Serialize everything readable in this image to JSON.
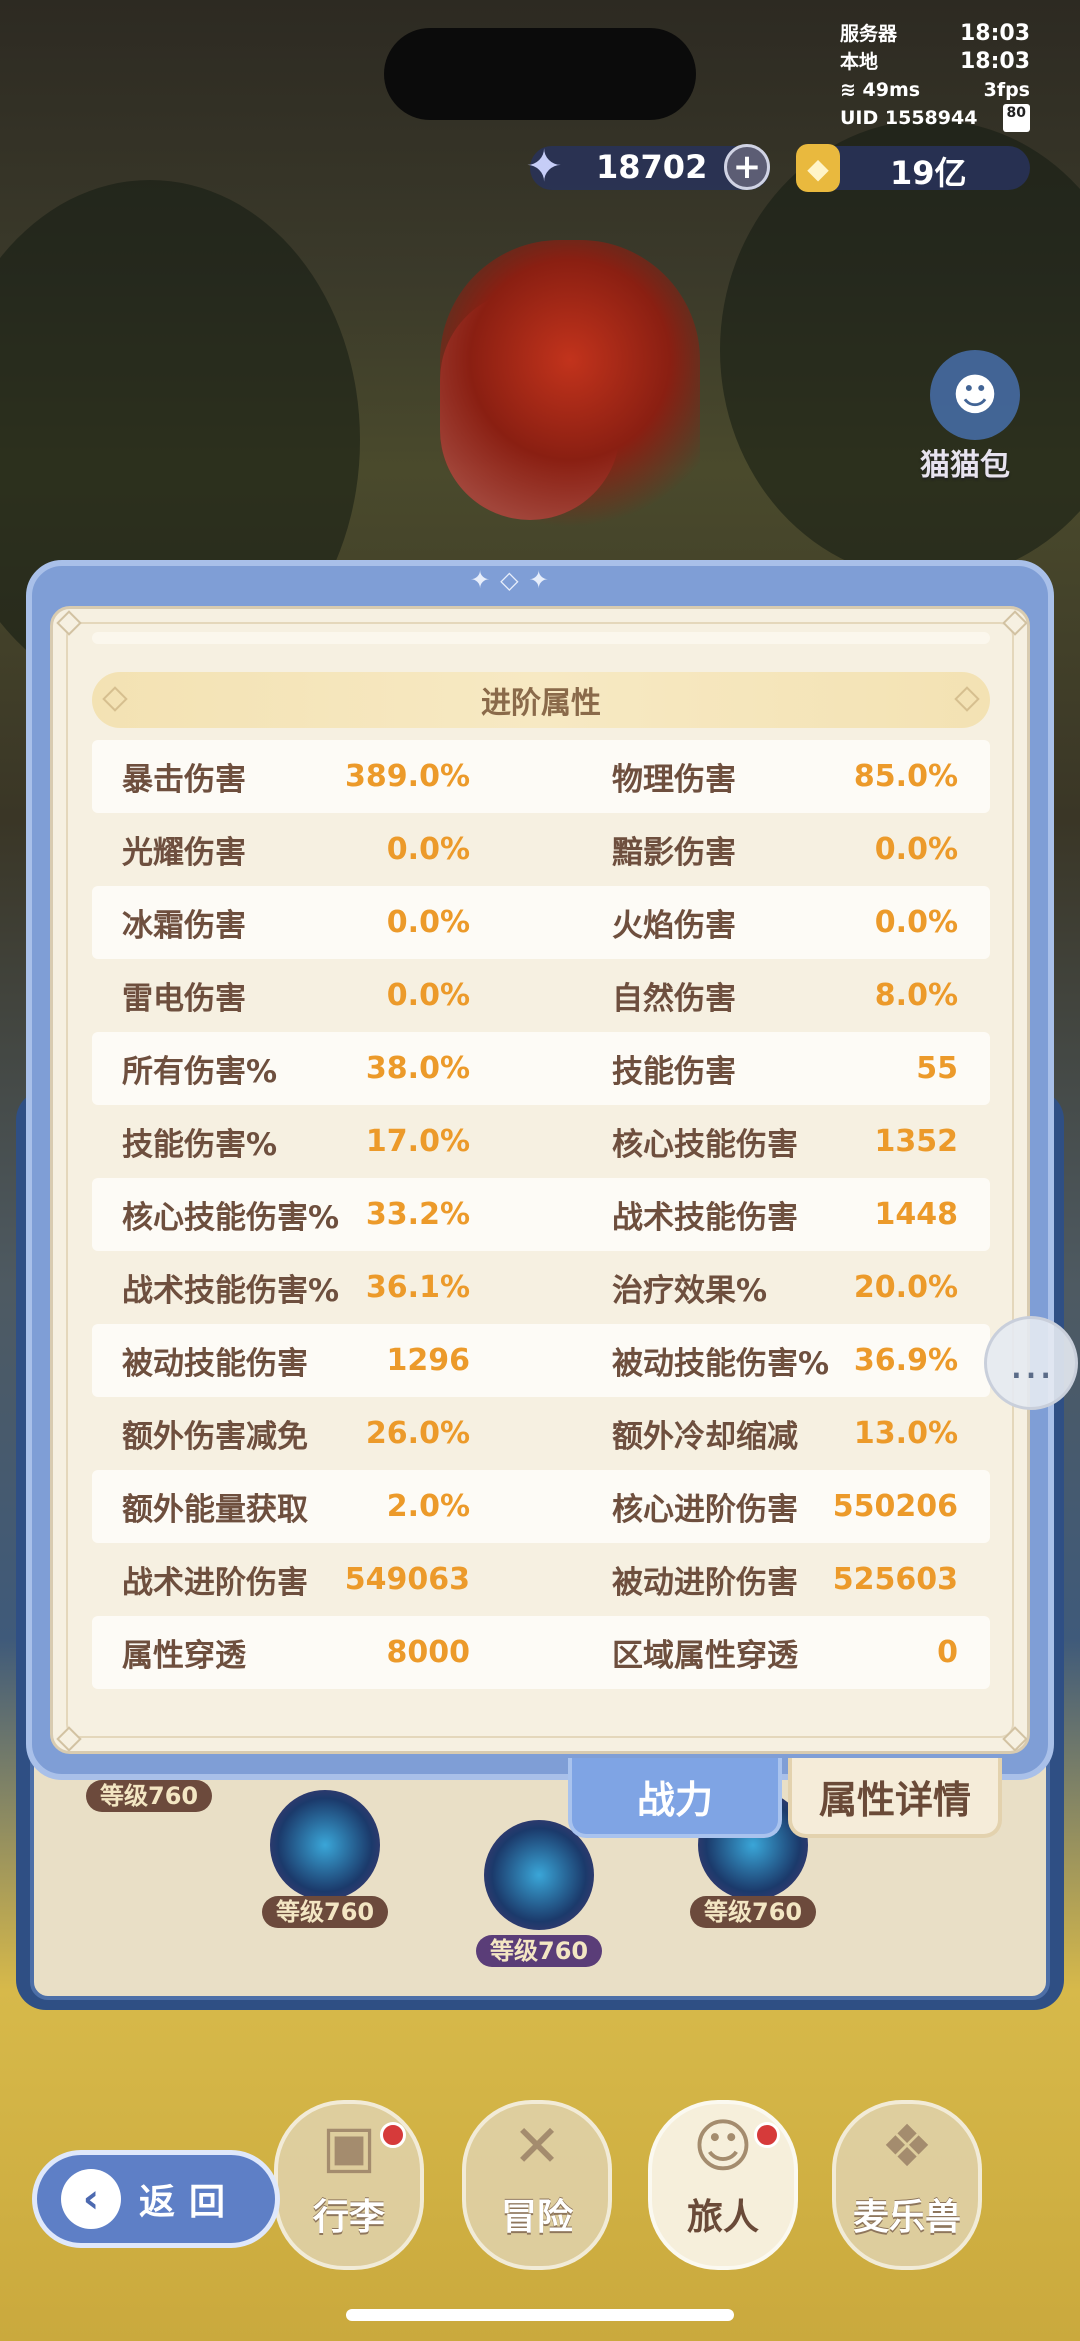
{
  "status": {
    "server_label": "服务器",
    "server_time": "18:03",
    "local_label": "本地",
    "local_time": "18:03",
    "ping": "49ms",
    "fps": "3fps",
    "uid": "UID 1558944",
    "fps_badge": "80"
  },
  "currency": {
    "gems": "18702",
    "gold": "19亿",
    "plus_symbol": "+"
  },
  "side_buttons": {
    "cat_bag_label": "猫猫包"
  },
  "panel": {
    "section_title": "进阶属性",
    "rows": [
      {
        "l_label": "暴击伤害",
        "l_value": "389.0%",
        "r_label": "物理伤害",
        "r_value": "85.0%"
      },
      {
        "l_label": "光耀伤害",
        "l_value": "0.0%",
        "r_label": "黯影伤害",
        "r_value": "0.0%"
      },
      {
        "l_label": "冰霜伤害",
        "l_value": "0.0%",
        "r_label": "火焰伤害",
        "r_value": "0.0%"
      },
      {
        "l_label": "雷电伤害",
        "l_value": "0.0%",
        "r_label": "自然伤害",
        "r_value": "8.0%"
      },
      {
        "l_label": "所有伤害%",
        "l_value": "38.0%",
        "r_label": "技能伤害",
        "r_value": "55"
      },
      {
        "l_label": "技能伤害%",
        "l_value": "17.0%",
        "r_label": "核心技能伤害",
        "r_value": "1352"
      },
      {
        "l_label": "核心技能伤害%",
        "l_value": "33.2%",
        "r_label": "战术技能伤害",
        "r_value": "1448"
      },
      {
        "l_label": "战术技能伤害%",
        "l_value": "36.1%",
        "r_label": "治疗效果%",
        "r_value": "20.0%"
      },
      {
        "l_label": "被动技能伤害",
        "l_value": "1296",
        "r_label": "被动技能伤害%",
        "r_value": "36.9%"
      },
      {
        "l_label": "额外伤害减免",
        "l_value": "26.0%",
        "r_label": "额外冷却缩减",
        "r_value": "13.0%"
      },
      {
        "l_label": "额外能量获取",
        "l_value": "2.0%",
        "r_label": "核心进阶伤害",
        "r_value": "550206"
      },
      {
        "l_label": "战术进阶伤害",
        "l_value": "549063",
        "r_label": "被动进阶伤害",
        "r_value": "525603"
      },
      {
        "l_label": "属性穿透",
        "l_value": "8000",
        "r_label": "区域属性穿透",
        "r_value": "0"
      }
    ]
  },
  "tabs": {
    "power": "战力",
    "detail": "属性详情"
  },
  "skills": {
    "levels": [
      "等级760",
      "等级760",
      "等级760",
      "等级760"
    ]
  },
  "nav": {
    "back": "返回",
    "items": [
      "行李",
      "冒险",
      "旅人",
      "麦乐兽"
    ]
  }
}
